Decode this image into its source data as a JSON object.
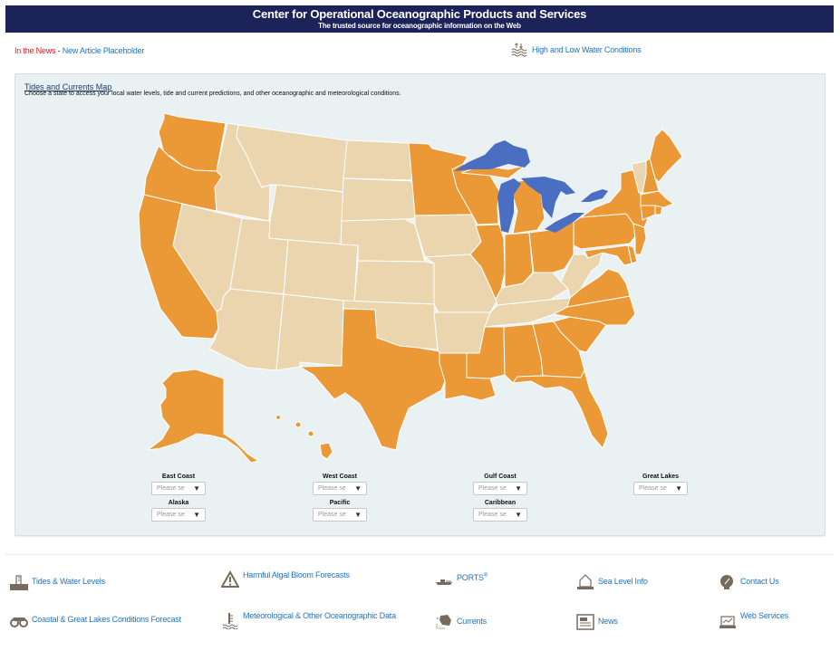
{
  "header": {
    "title": "Center for Operational Oceanographic Products and Services",
    "subtitle": "The trusted source for oceanographic information on the Web"
  },
  "news": {
    "label": "In the News",
    "separator": " - ",
    "article": "New Article Placeholder"
  },
  "high_low": {
    "icon": "tide-arrows-icon",
    "label": "High and Low Water Conditions"
  },
  "map": {
    "title": "Tides and Currents Map",
    "description": "Choose a state to access your local water levels, tide and current predictions, and other oceanographic and meteorological conditions.",
    "colors": {
      "coastal": "#eb9836",
      "inland": "#ead5af",
      "lakes": "#4a6fc2",
      "background": "#eaf1f3"
    },
    "coastal_states": [
      "WA",
      "OR",
      "CA",
      "AK",
      "HI",
      "TX",
      "LA",
      "MS",
      "AL",
      "GA",
      "FL",
      "SC",
      "NC",
      "VA",
      "MD",
      "DE",
      "NJ",
      "PA",
      "NY",
      "CT",
      "RI",
      "MA",
      "NH",
      "ME",
      "MN",
      "WI",
      "MI",
      "IL",
      "IN",
      "OH"
    ],
    "inland_states": [
      "ID",
      "MT",
      "WY",
      "NV",
      "UT",
      "CO",
      "AZ",
      "NM",
      "ND",
      "SD",
      "NE",
      "KS",
      "OK",
      "IA",
      "MO",
      "AR",
      "KY",
      "TN",
      "WV",
      "VT"
    ]
  },
  "regions": [
    {
      "label": "East Coast",
      "placeholder": "Please se"
    },
    {
      "label": "West Coast",
      "placeholder": "Please se"
    },
    {
      "label": "Gulf Coast",
      "placeholder": "Please se"
    },
    {
      "label": "Great Lakes",
      "placeholder": "Please se"
    },
    {
      "label": "Alaska",
      "placeholder": "Please se"
    },
    {
      "label": "Pacific",
      "placeholder": "Please se"
    },
    {
      "label": "Caribbean",
      "placeholder": "Please se"
    }
  ],
  "footer_links": [
    {
      "icon": "tide-gauge-icon",
      "label": "Tides & Water Levels"
    },
    {
      "icon": "warning-icon",
      "label": "Harmful Algal Bloom Forecasts"
    },
    {
      "icon": "ship-icon",
      "label": "PORTS",
      "sup": "®"
    },
    {
      "icon": "sea-level-icon",
      "label": "Sea Level Info"
    },
    {
      "icon": "contact-icon",
      "label": "Contact Us"
    },
    {
      "icon": "binoculars-icon",
      "label": "Coastal & Great Lakes Conditions Forecast"
    },
    {
      "icon": "thermometer-icon",
      "label": "Meteorological & Other Oceanographic Data"
    },
    {
      "icon": "currents-icon",
      "label": "Currents"
    },
    {
      "icon": "news-icon",
      "label": "News"
    },
    {
      "icon": "web-services-icon",
      "label": "Web Services"
    }
  ]
}
